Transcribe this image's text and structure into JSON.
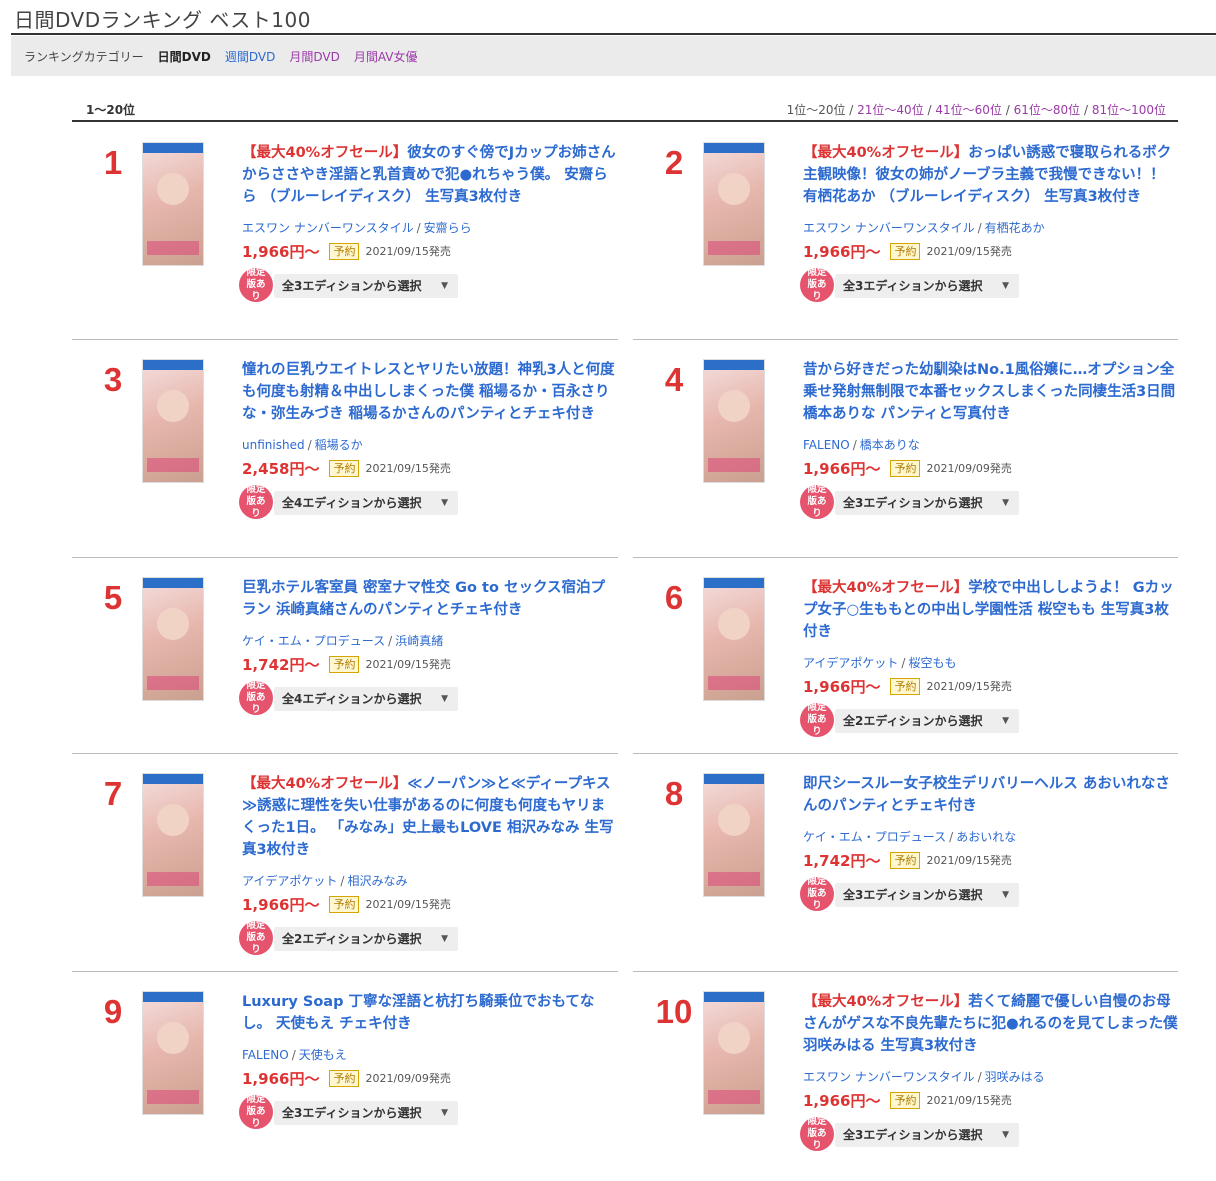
{
  "page": {
    "title": "日間DVDランキング ベスト100"
  },
  "category_bar": {
    "label": "ランキングカテゴリー",
    "current": "日間DVD",
    "links": [
      "週間DVD",
      "月間DVD",
      "月間AV女優"
    ]
  },
  "range": {
    "current": "1〜20位",
    "pages": [
      "1位〜20位",
      "21位〜40位",
      "41位〜60位",
      "61位〜80位",
      "81位〜100位"
    ]
  },
  "colors": {
    "rank": "#dd3333",
    "title_link": "#2c6ad0",
    "visited_link": "#9b3aa8",
    "price": "#dd3333",
    "limited_badge": "#e5536d"
  },
  "labels": {
    "limited": "限定版あり",
    "limited_line1": "限定版",
    "limited_line2": "あり",
    "reserve": "予約"
  },
  "items": [
    {
      "rank": "1",
      "sale": "【最大40%オフセール】",
      "title": "彼女のすぐ傍でJカップお姉さんからささやき淫語と乳首責めで犯●れちゃう僕。 安齋らら （ブルーレイディスク） 生写真3枚付き",
      "maker": "エスワン ナンバーワンスタイル",
      "actress": "安齋らら",
      "price": "1,966円〜",
      "date": "2021/09/15発売",
      "edition": "全3エディションから選択"
    },
    {
      "rank": "2",
      "sale": "【最大40%オフセール】",
      "title": "おっぱい誘惑で寝取られるボク主観映像！彼女の姉がノーブラ主義で我慢できない！！ 有栖花あか （ブルーレイディスク） 生写真3枚付き",
      "maker": "エスワン ナンバーワンスタイル",
      "actress": "有栖花あか",
      "price": "1,966円〜",
      "date": "2021/09/15発売",
      "edition": "全3エディションから選択"
    },
    {
      "rank": "3",
      "sale": "",
      "title": "憧れの巨乳ウエイトレスとヤリたい放題！神乳3人と何度も何度も射精＆中出ししまくった僕 稲場るか・百永さりな・弥生みづき 稲場るかさんのパンティとチェキ付き",
      "maker": "unfinished",
      "actress": "稲場るか",
      "price": "2,458円〜",
      "date": "2021/09/15発売",
      "edition": "全4エディションから選択"
    },
    {
      "rank": "4",
      "sale": "",
      "title": "昔から好きだった幼馴染はNo.1風俗嬢に…オプション全乗せ発射無制限で本番セックスしまくった同棲生活3日間 橋本ありな パンティと写真付き",
      "maker": "FALENO",
      "actress": "橋本ありな",
      "price": "1,966円〜",
      "date": "2021/09/09発売",
      "edition": "全3エディションから選択"
    },
    {
      "rank": "5",
      "sale": "",
      "title": "巨乳ホテル客室員 密室ナマ性交 Go to セックス宿泊プラン 浜崎真緒さんのパンティとチェキ付き",
      "maker": "ケイ・エム・プロデュース",
      "actress": "浜崎真緒",
      "price": "1,742円〜",
      "date": "2021/09/15発売",
      "edition": "全4エディションから選択"
    },
    {
      "rank": "6",
      "sale": "【最大40%オフセール】",
      "title": "学校で中出ししようよ！ Gカップ女子○生ももとの中出し学園性活 桜空もも 生写真3枚付き",
      "maker": "アイデアポケット",
      "actress": "桜空もも",
      "price": "1,966円〜",
      "date": "2021/09/15発売",
      "edition": "全2エディションから選択"
    },
    {
      "rank": "7",
      "sale": "【最大40%オフセール】",
      "title": "≪ノーパン≫と≪ディープキス≫誘惑に理性を失い仕事があるのに何度も何度もヤリまくった1日。 「みなみ」史上最もLOVE 相沢みなみ 生写真3枚付き",
      "maker": "アイデアポケット",
      "actress": "相沢みなみ",
      "price": "1,966円〜",
      "date": "2021/09/15発売",
      "edition": "全2エディションから選択"
    },
    {
      "rank": "8",
      "sale": "",
      "title": "即尺シースルー女子校生デリバリーヘルス あおいれなさんのパンティとチェキ付き",
      "maker": "ケイ・エム・プロデュース",
      "actress": "あおいれな",
      "price": "1,742円〜",
      "date": "2021/09/15発売",
      "edition": "全3エディションから選択"
    },
    {
      "rank": "9",
      "sale": "",
      "title": "Luxury Soap 丁寧な淫語と杭打ち騎乗位でおもてなし。 天使もえ チェキ付き",
      "maker": "FALENO",
      "actress": "天使もえ",
      "price": "1,966円〜",
      "date": "2021/09/09発売",
      "edition": "全3エディションから選択"
    },
    {
      "rank": "10",
      "sale": "【最大40%オフセール】",
      "title": "若くて綺麗で優しい自慢のお母さんがゲスな不良先輩たちに犯●れるのを見てしまった僕 羽咲みはる 生写真3枚付き",
      "maker": "エスワン ナンバーワンスタイル",
      "actress": "羽咲みはる",
      "price": "1,966円〜",
      "date": "2021/09/15発売",
      "edition": "全3エディションから選択"
    }
  ]
}
